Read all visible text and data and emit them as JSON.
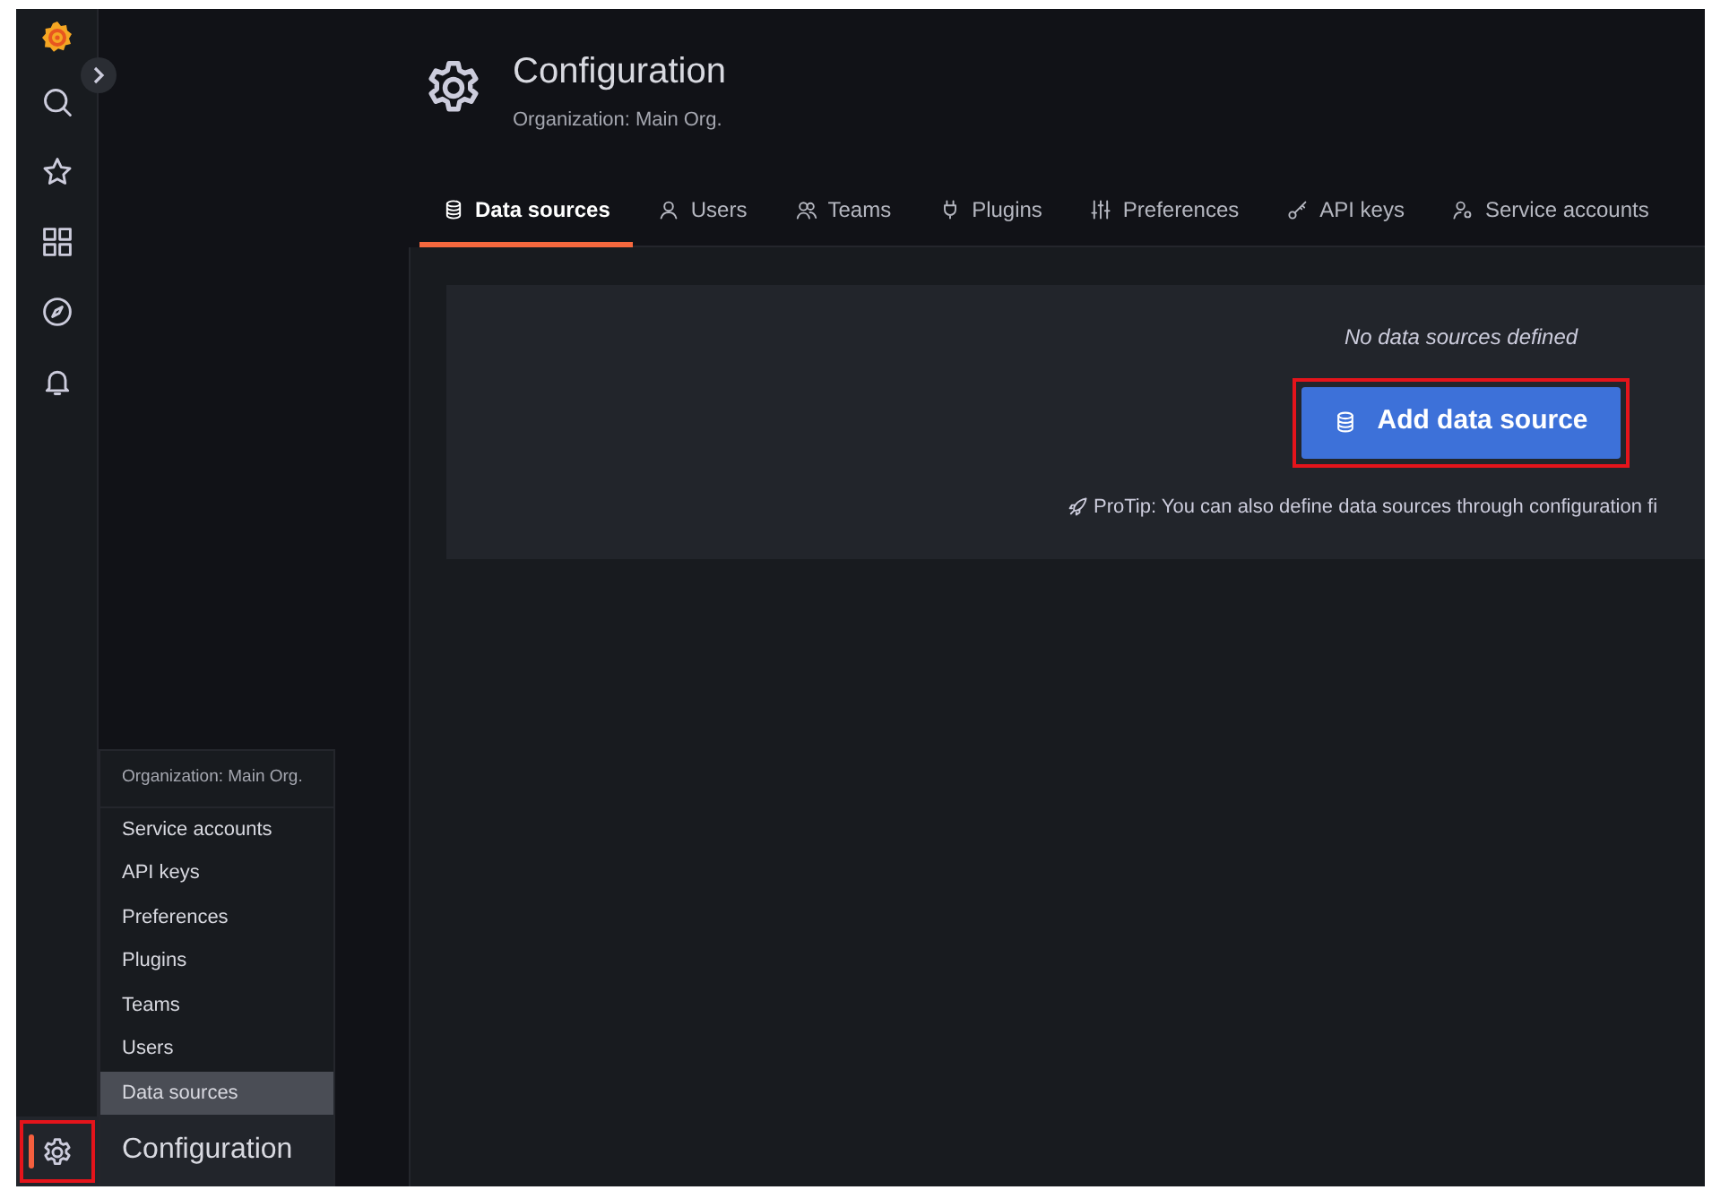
{
  "sidebar": {
    "items": [
      {
        "kind": "search",
        "selected": false,
        "highlighted": false
      },
      {
        "kind": "starred",
        "selected": false,
        "highlighted": false
      },
      {
        "kind": "dashboards",
        "selected": false,
        "highlighted": false
      },
      {
        "kind": "explore",
        "selected": false,
        "highlighted": false
      },
      {
        "kind": "alerting",
        "selected": false,
        "highlighted": false
      },
      {
        "kind": "configuration",
        "selected": true,
        "highlighted": true
      }
    ]
  },
  "header": {
    "title": "Configuration",
    "subtitle": "Organization: Main Org."
  },
  "tabs": [
    {
      "label": "Data sources",
      "kind": "database",
      "selected": true
    },
    {
      "label": "Users",
      "kind": "user",
      "selected": false
    },
    {
      "label": "Teams",
      "kind": "users",
      "selected": false
    },
    {
      "label": "Plugins",
      "kind": "plug",
      "selected": false
    },
    {
      "label": "Preferences",
      "kind": "sliders",
      "selected": false
    },
    {
      "label": "API keys",
      "kind": "key",
      "selected": false
    },
    {
      "label": "Service accounts",
      "kind": "user-cog",
      "selected": false
    }
  ],
  "empty_state": {
    "message": "No data sources defined",
    "button": {
      "label": "Add data source",
      "highlighted": true
    },
    "protip": "ProTip: You can also define data sources through configuration fi"
  },
  "menu": {
    "header": "Organization: Main Org.",
    "items": [
      {
        "label": "Service accounts",
        "selected": false
      },
      {
        "label": "API keys",
        "selected": false
      },
      {
        "label": "Preferences",
        "selected": false
      },
      {
        "label": "Plugins",
        "selected": false
      },
      {
        "label": "Teams",
        "selected": false
      },
      {
        "label": "Users",
        "selected": false
      },
      {
        "label": "Data sources",
        "selected": true
      }
    ],
    "title": "Configuration"
  }
}
